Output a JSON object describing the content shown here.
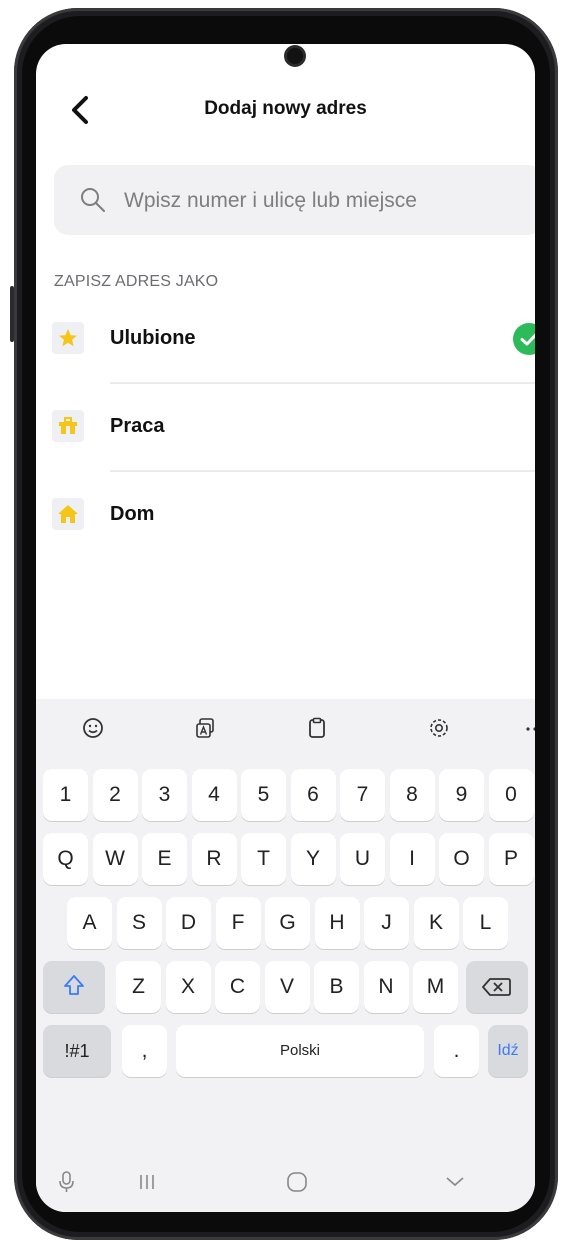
{
  "header": {
    "title": "Dodaj nowy adres"
  },
  "search": {
    "placeholder": "Wpisz numer i ulicę lub miejsce"
  },
  "section_label": "ZAPISZ ADRES JAKO",
  "address_types": [
    {
      "label": "Ulubione",
      "icon": "star-icon",
      "selected": true
    },
    {
      "label": "Praca",
      "icon": "briefcase-icon",
      "selected": false
    },
    {
      "label": "Dom",
      "icon": "home-icon",
      "selected": false
    }
  ],
  "colors": {
    "accent_yellow": "#f5c518",
    "check_green": "#2dba5b"
  },
  "keyboard": {
    "toolbar": [
      "emoji-icon",
      "translate-icon",
      "clipboard-icon",
      "settings-icon",
      "more-icon"
    ],
    "row_numbers": [
      "1",
      "2",
      "3",
      "4",
      "5",
      "6",
      "7",
      "8",
      "9",
      "0"
    ],
    "row_top": [
      "Q",
      "W",
      "E",
      "R",
      "T",
      "Y",
      "U",
      "I",
      "O",
      "P"
    ],
    "row_middle": [
      "A",
      "S",
      "D",
      "F",
      "G",
      "H",
      "J",
      "K",
      "L"
    ],
    "row_bottom": [
      "Z",
      "X",
      "C",
      "V",
      "B",
      "N",
      "M"
    ],
    "symbols_label": "!#1",
    "comma_label": ",",
    "space_label": "Polski",
    "period_label": ".",
    "go_label": "Idź"
  }
}
